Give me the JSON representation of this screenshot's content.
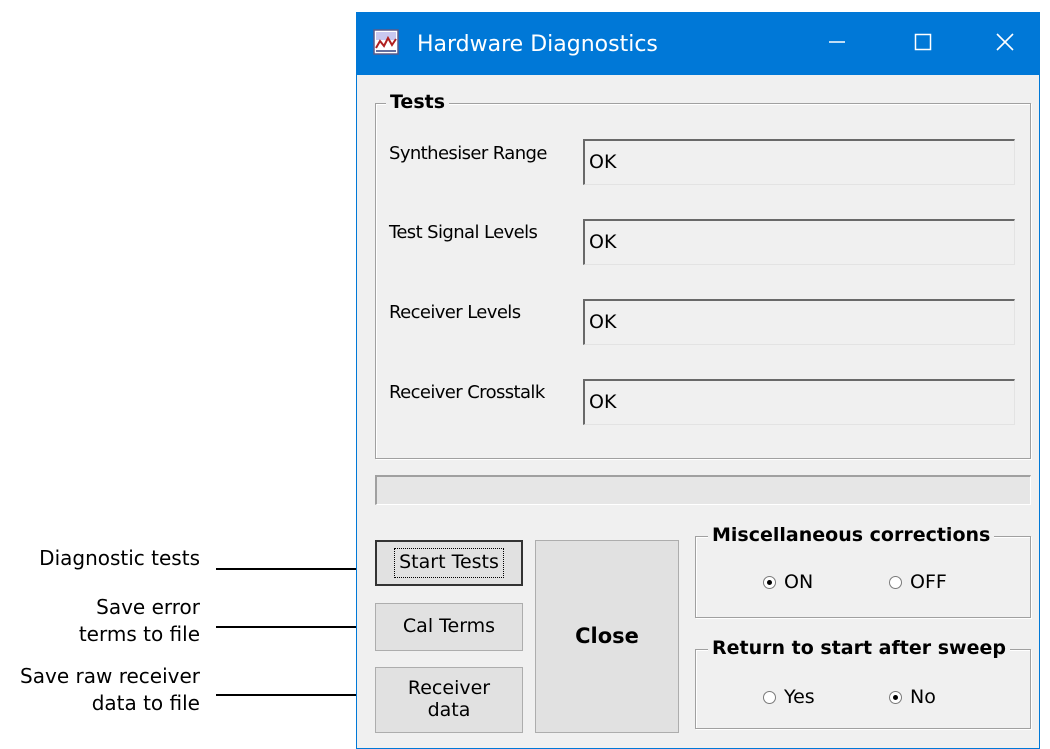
{
  "window": {
    "title": "Hardware Diagnostics",
    "accent_color": "#0078d7",
    "icons": {
      "app": "chart-icon",
      "minimize": "minimize-icon",
      "maximize": "maximize-icon",
      "close": "close-icon"
    }
  },
  "tests": {
    "legend": "Tests",
    "rows": [
      {
        "label": "Synthesiser Range",
        "value": "OK"
      },
      {
        "label": "Test Signal Levels",
        "value": "OK"
      },
      {
        "label": "Receiver Levels",
        "value": "OK"
      },
      {
        "label": "Receiver Crosstalk",
        "value": "OK"
      }
    ]
  },
  "progress": {
    "fraction": 0
  },
  "buttons": {
    "start_tests": "Start Tests",
    "cal_terms": "Cal Terms",
    "receiver_data_line1": "Receiver",
    "receiver_data_line2": "data",
    "close": "Close"
  },
  "misc_corrections": {
    "legend": "Miscellaneous corrections",
    "options": [
      {
        "label": "ON",
        "checked": true
      },
      {
        "label": "OFF",
        "checked": false
      }
    ]
  },
  "return_to_start": {
    "legend": "Return to start after sweep",
    "options": [
      {
        "label": "Yes",
        "checked": false
      },
      {
        "label": "No",
        "checked": true
      }
    ]
  },
  "annotations": {
    "diagnostic_tests": "Diagnostic tests",
    "save_error_line1": "Save error",
    "save_error_line2": "terms to file",
    "save_raw_line1": "Save raw receiver",
    "save_raw_line2": "data to file"
  }
}
